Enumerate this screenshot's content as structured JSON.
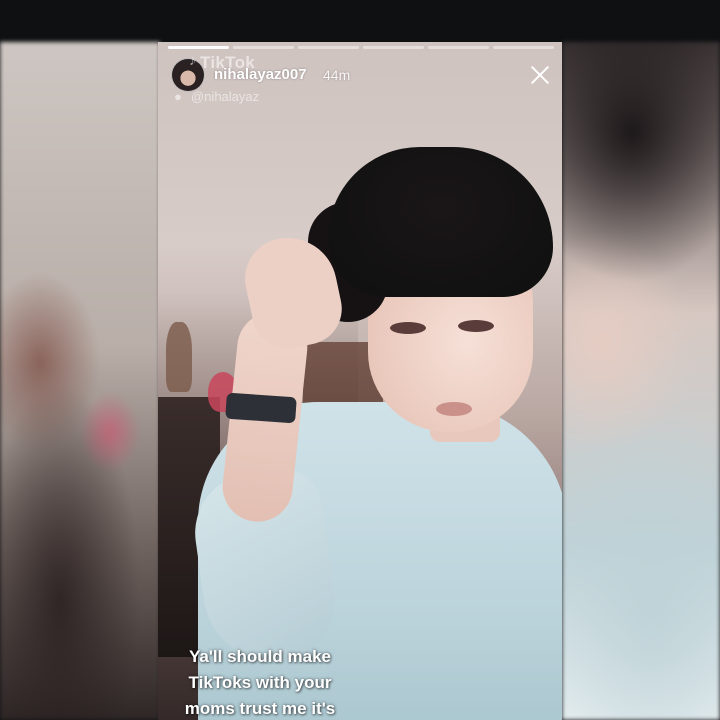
{
  "story": {
    "watermark": "TikTok",
    "username": "nihalayaz007",
    "timestamp": "44m",
    "handle": "@nihalayaz",
    "progress": {
      "segments": 6,
      "active_segment": 1
    },
    "caption_lines": [
      "Ya'll should make",
      "TikToks with your",
      "moms trust me it's"
    ]
  },
  "icons": {
    "close": "close-icon",
    "avatar": "profile-avatar",
    "tiktok": "tiktok-note-icon",
    "user": "user-icon"
  },
  "colors": {
    "background": "#111214",
    "text": "#ffffff"
  }
}
